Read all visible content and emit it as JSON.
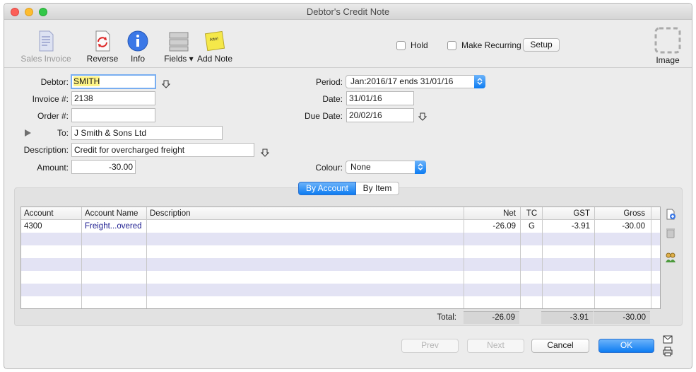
{
  "window": {
    "title": "Debtor's Credit Note"
  },
  "toolbar": {
    "sales_invoice": "Sales Invoice",
    "reverse": "Reverse",
    "info": "Info",
    "fields": "Fields",
    "add_note": "Add Note",
    "note_icon_text": "Attn!",
    "hold": "Hold",
    "make_recurring": "Make Recurring",
    "setup": "Setup",
    "image": "Image"
  },
  "form": {
    "debtor_label": "Debtor:",
    "debtor_value": "SMITH",
    "invoice_label": "Invoice #:",
    "invoice_value": "2138",
    "order_label": "Order #:",
    "order_value": "",
    "to_label": "To:",
    "to_value": "J Smith & Sons Ltd",
    "description_label": "Description:",
    "description_value": "Credit for overcharged freight",
    "amount_label": "Amount:",
    "amount_value": "-30.00",
    "period_label": "Period:",
    "period_value": "Jan:2016/17 ends 31/01/16",
    "date_label": "Date:",
    "date_value": "31/01/16",
    "due_date_label": "Due Date:",
    "due_date_value": "20/02/16",
    "colour_label": "Colour:",
    "colour_value": "None"
  },
  "tabs": {
    "by_account": "By Account",
    "by_item": "By Item"
  },
  "table": {
    "columns": [
      "Account",
      "Account Name",
      "Description",
      "Net",
      "TC",
      "GST",
      "Gross"
    ],
    "rows": [
      {
        "account": "4300",
        "account_name": "Freight...overed",
        "description": "",
        "net": "-26.09",
        "tc": "G",
        "gst": "-3.91",
        "gross": "-30.00"
      }
    ],
    "totals": {
      "label": "Total:",
      "net": "-26.09",
      "gst": "-3.91",
      "gross": "-30.00"
    }
  },
  "buttons": {
    "prev": "Prev",
    "next": "Next",
    "cancel": "Cancel",
    "ok": "OK"
  },
  "colors": {
    "accent": "#0d7cf2",
    "band": "#e3e3f4",
    "highlight": "#fef486"
  }
}
